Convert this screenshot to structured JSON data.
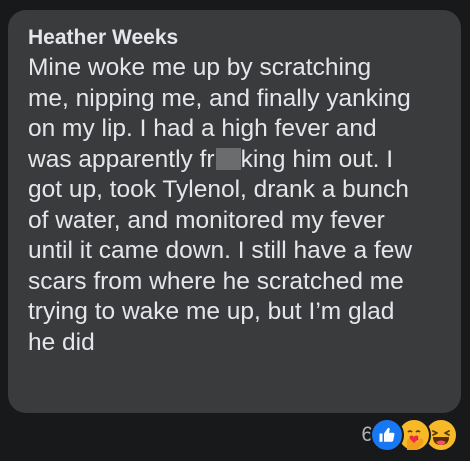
{
  "comment": {
    "author": "Heather Weeks",
    "lines": {
      "l1": "Mine woke me up by scratching",
      "l2": "me, nipping me, and finally yanking",
      "l3": "on my lip. I had a high fever and",
      "l4a": "was apparently fr",
      "l4b": "king him out. I",
      "l5": "got up, took Tylenol, drank a bunch",
      "l6": "of water, and monitored my fever",
      "l7": "until it came down. I still have a few",
      "l8": "scars from where he scratched me",
      "l9": "trying to wake me up, but I’m glad",
      "l10": "he did"
    }
  },
  "reactions": {
    "count": "6",
    "icons": [
      "like-icon",
      "care-icon",
      "haha-icon"
    ]
  },
  "colors": {
    "background": "#18191a",
    "bubble": "#3a3b3c",
    "text": "#e4e6eb",
    "muted": "#b0b3b8",
    "like_blue": "#1877f2",
    "emoji_yellow": "#f7b928"
  }
}
